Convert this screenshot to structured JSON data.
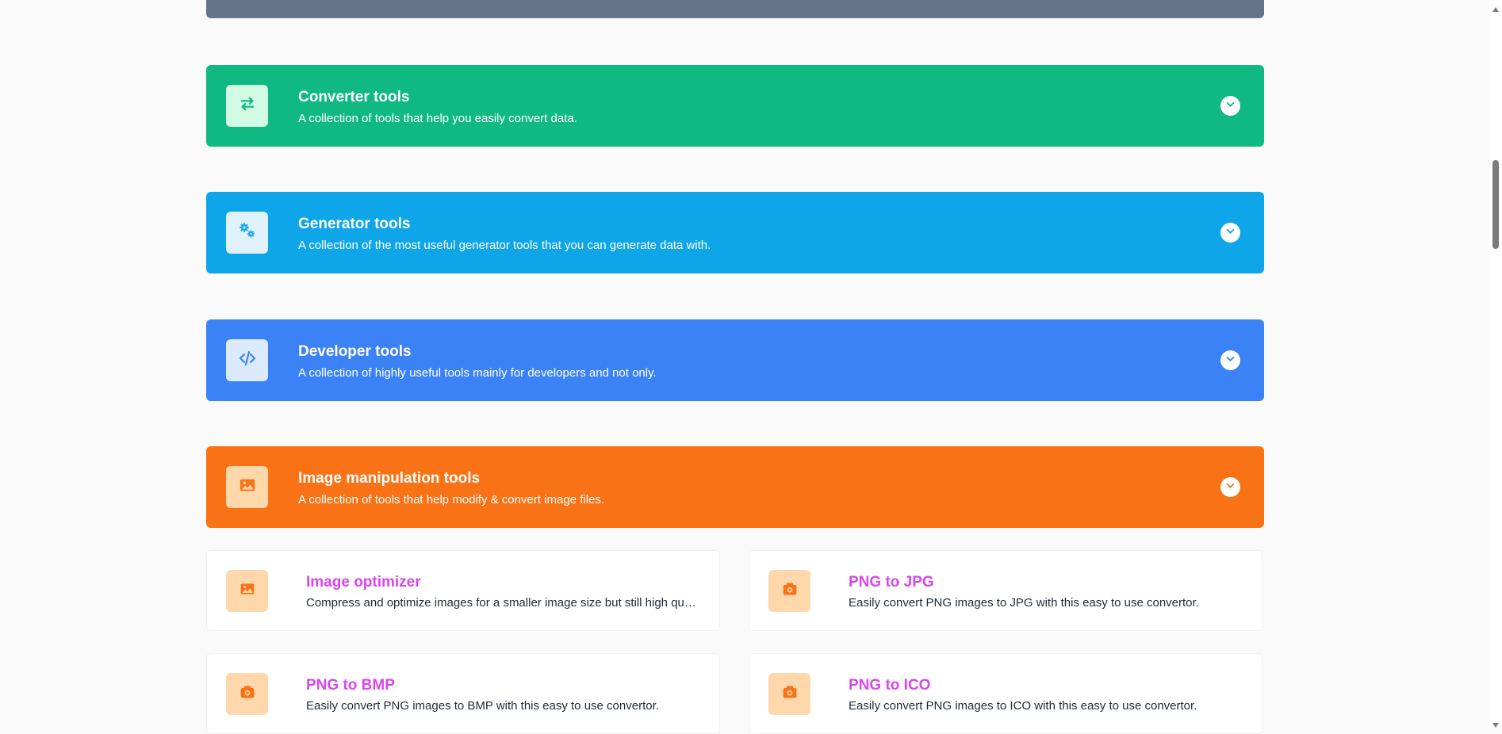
{
  "colors": {
    "page_background": "#fafafa",
    "top_strip": "#64748b",
    "converter": "#10b981",
    "generator": "#0ea5e9",
    "developer": "#3b82f6",
    "image": "#f97316",
    "tool_title": "#d946ef",
    "tool_icon_bg": "#fed7aa",
    "tool_icon": "#f97316"
  },
  "categories": [
    {
      "title": "Converter tools",
      "description": "A collection of tools that help you easily convert data.",
      "icon": "arrows-left-right-icon"
    },
    {
      "title": "Generator tools",
      "description": "A collection of the most useful generator tools that you can generate data with.",
      "icon": "gears-icon"
    },
    {
      "title": "Developer tools",
      "description": "A collection of highly useful tools mainly for developers and not only.",
      "icon": "code-icon"
    },
    {
      "title": "Image manipulation tools",
      "description": "A collection of tools that help modify & convert image files.",
      "icon": "image-icon"
    }
  ],
  "tools": [
    {
      "title": "Image optimizer",
      "description": "Compress and optimize images for a smaller image size but still high quality.",
      "icon": "image-icon"
    },
    {
      "title": "PNG to JPG",
      "description": "Easily convert PNG images to JPG with this easy to use convertor.",
      "icon": "camera-icon"
    },
    {
      "title": "PNG to BMP",
      "description": "Easily convert PNG images to BMP with this easy to use convertor.",
      "icon": "camera-icon"
    },
    {
      "title": "PNG to ICO",
      "description": "Easily convert PNG images to ICO with this easy to use convertor.",
      "icon": "camera-icon"
    }
  ]
}
